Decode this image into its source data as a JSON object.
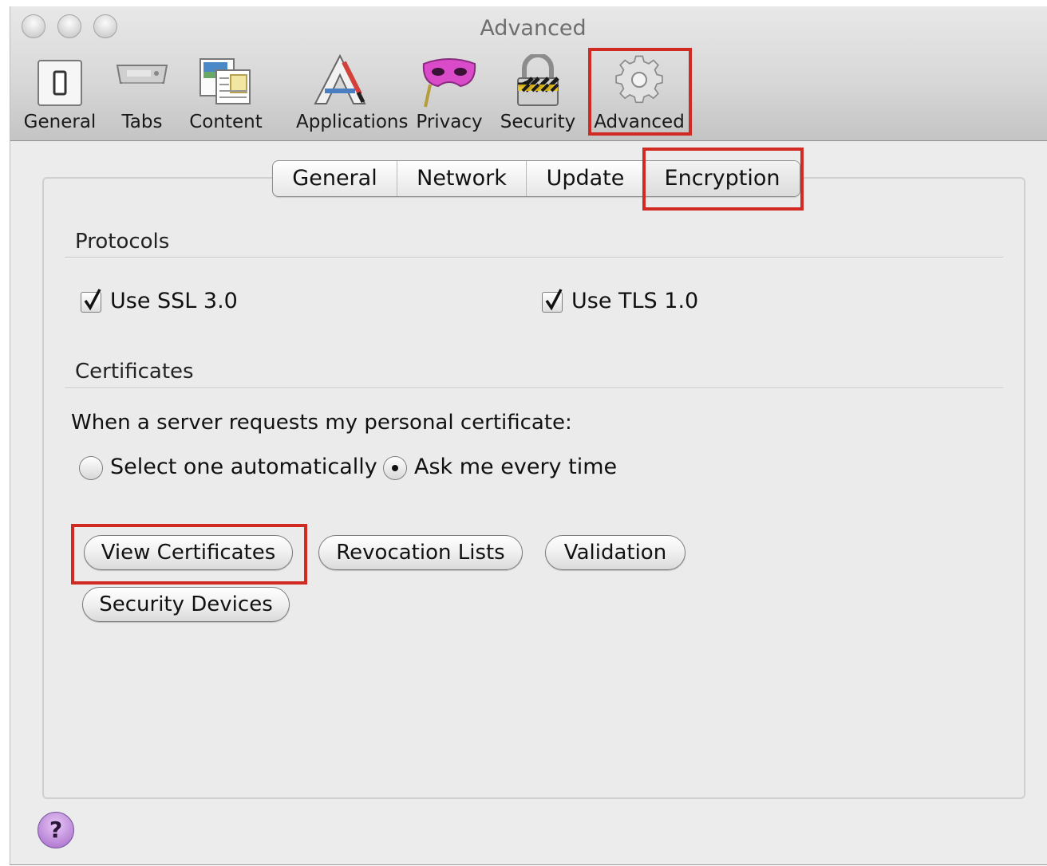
{
  "window": {
    "title": "Advanced"
  },
  "toolbar": {
    "items": [
      {
        "label": "General",
        "icon": "switch-icon"
      },
      {
        "label": "Tabs",
        "icon": "tabs-icon"
      },
      {
        "label": "Content",
        "icon": "content-icon"
      },
      {
        "label": "Applications",
        "icon": "applications-icon"
      },
      {
        "label": "Privacy",
        "icon": "mask-icon"
      },
      {
        "label": "Security",
        "icon": "padlock-icon"
      },
      {
        "label": "Advanced",
        "icon": "gear-icon",
        "selected": true
      }
    ]
  },
  "tabs": [
    {
      "label": "General"
    },
    {
      "label": "Network"
    },
    {
      "label": "Update"
    },
    {
      "label": "Encryption",
      "selected": true
    }
  ],
  "protocols": {
    "heading": "Protocols",
    "ssl": {
      "label": "Use SSL 3.0",
      "checked": true
    },
    "tls": {
      "label": "Use TLS 1.0",
      "checked": true
    }
  },
  "certificates": {
    "heading": "Certificates",
    "prompt": "When a server requests my personal certificate:",
    "options": [
      {
        "label": "Select one automatically",
        "selected": false
      },
      {
        "label": "Ask me every time",
        "selected": true
      }
    ],
    "buttons": {
      "view": "View Certificates",
      "revocation": "Revocation Lists",
      "validation": "Validation",
      "devices": "Security Devices"
    }
  },
  "help": {
    "label": "?"
  },
  "highlight_color": "#d02a22"
}
